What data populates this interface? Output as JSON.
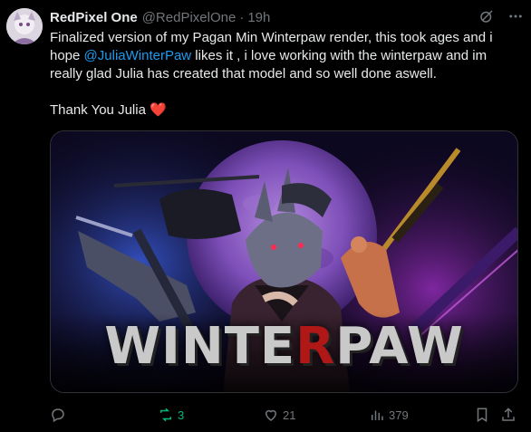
{
  "tweet": {
    "author_name": "RedPixel One",
    "author_handle": "@RedPixelOne",
    "separator": "·",
    "time": "19h",
    "line1_text_a": "Finalized version of my Pagan Min Winterpaw render, this took ages and i hope ",
    "mention": "@JuliaWinterPaw",
    "line1_text_b": " likes it , i love working with the winterpaw and im really glad Julia has created that model and so well done aswell.",
    "line2_text": "Thank You Julia ",
    "heart_emoji": "❤️",
    "image_title_part1": "WINTE",
    "image_title_red": "R",
    "image_title_part2": "PAW"
  },
  "actions": {
    "reply_count": "",
    "repost_count": "3",
    "like_count": "21",
    "views_count": "379"
  },
  "icons": {
    "grok": "grok-icon",
    "more": "more-icon",
    "reply": "reply-icon",
    "repost": "repost-icon",
    "like": "like-icon",
    "views": "views-icon",
    "bookmark": "bookmark-icon",
    "share": "share-icon"
  },
  "colors": {
    "background": "#000000",
    "text": "#e7e9ea",
    "muted": "#71767b",
    "link": "#1d9bf0",
    "repost": "#00ba7c",
    "heart": "#f91880"
  }
}
